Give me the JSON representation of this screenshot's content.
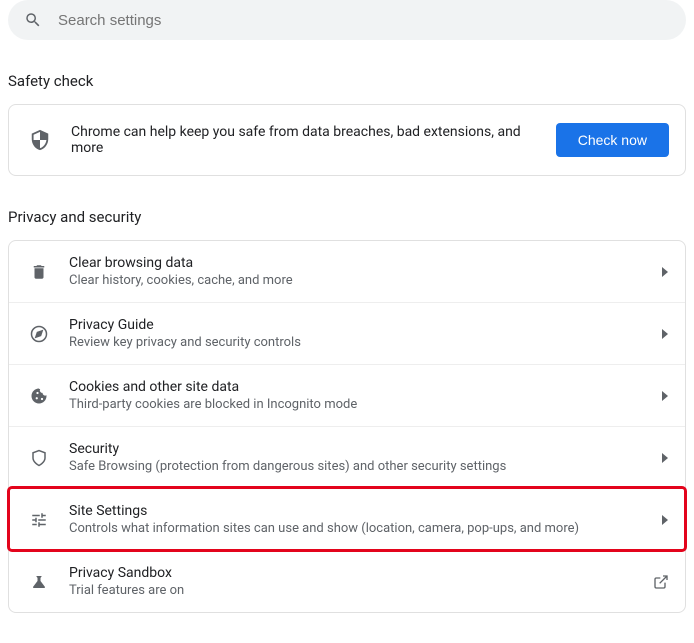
{
  "search": {
    "placeholder": "Search settings"
  },
  "safety": {
    "header": "Safety check",
    "text": "Chrome can help keep you safe from data breaches, bad extensions, and more",
    "button": "Check now"
  },
  "privacy": {
    "header": "Privacy and security",
    "items": [
      {
        "title": "Clear browsing data",
        "subtitle": "Clear history, cookies, cache, and more"
      },
      {
        "title": "Privacy Guide",
        "subtitle": "Review key privacy and security controls"
      },
      {
        "title": "Cookies and other site data",
        "subtitle": "Third-party cookies are blocked in Incognito mode"
      },
      {
        "title": "Security",
        "subtitle": "Safe Browsing (protection from dangerous sites) and other security settings"
      },
      {
        "title": "Site Settings",
        "subtitle": "Controls what information sites can use and show (location, camera, pop-ups, and more)"
      },
      {
        "title": "Privacy Sandbox",
        "subtitle": "Trial features are on"
      }
    ]
  }
}
